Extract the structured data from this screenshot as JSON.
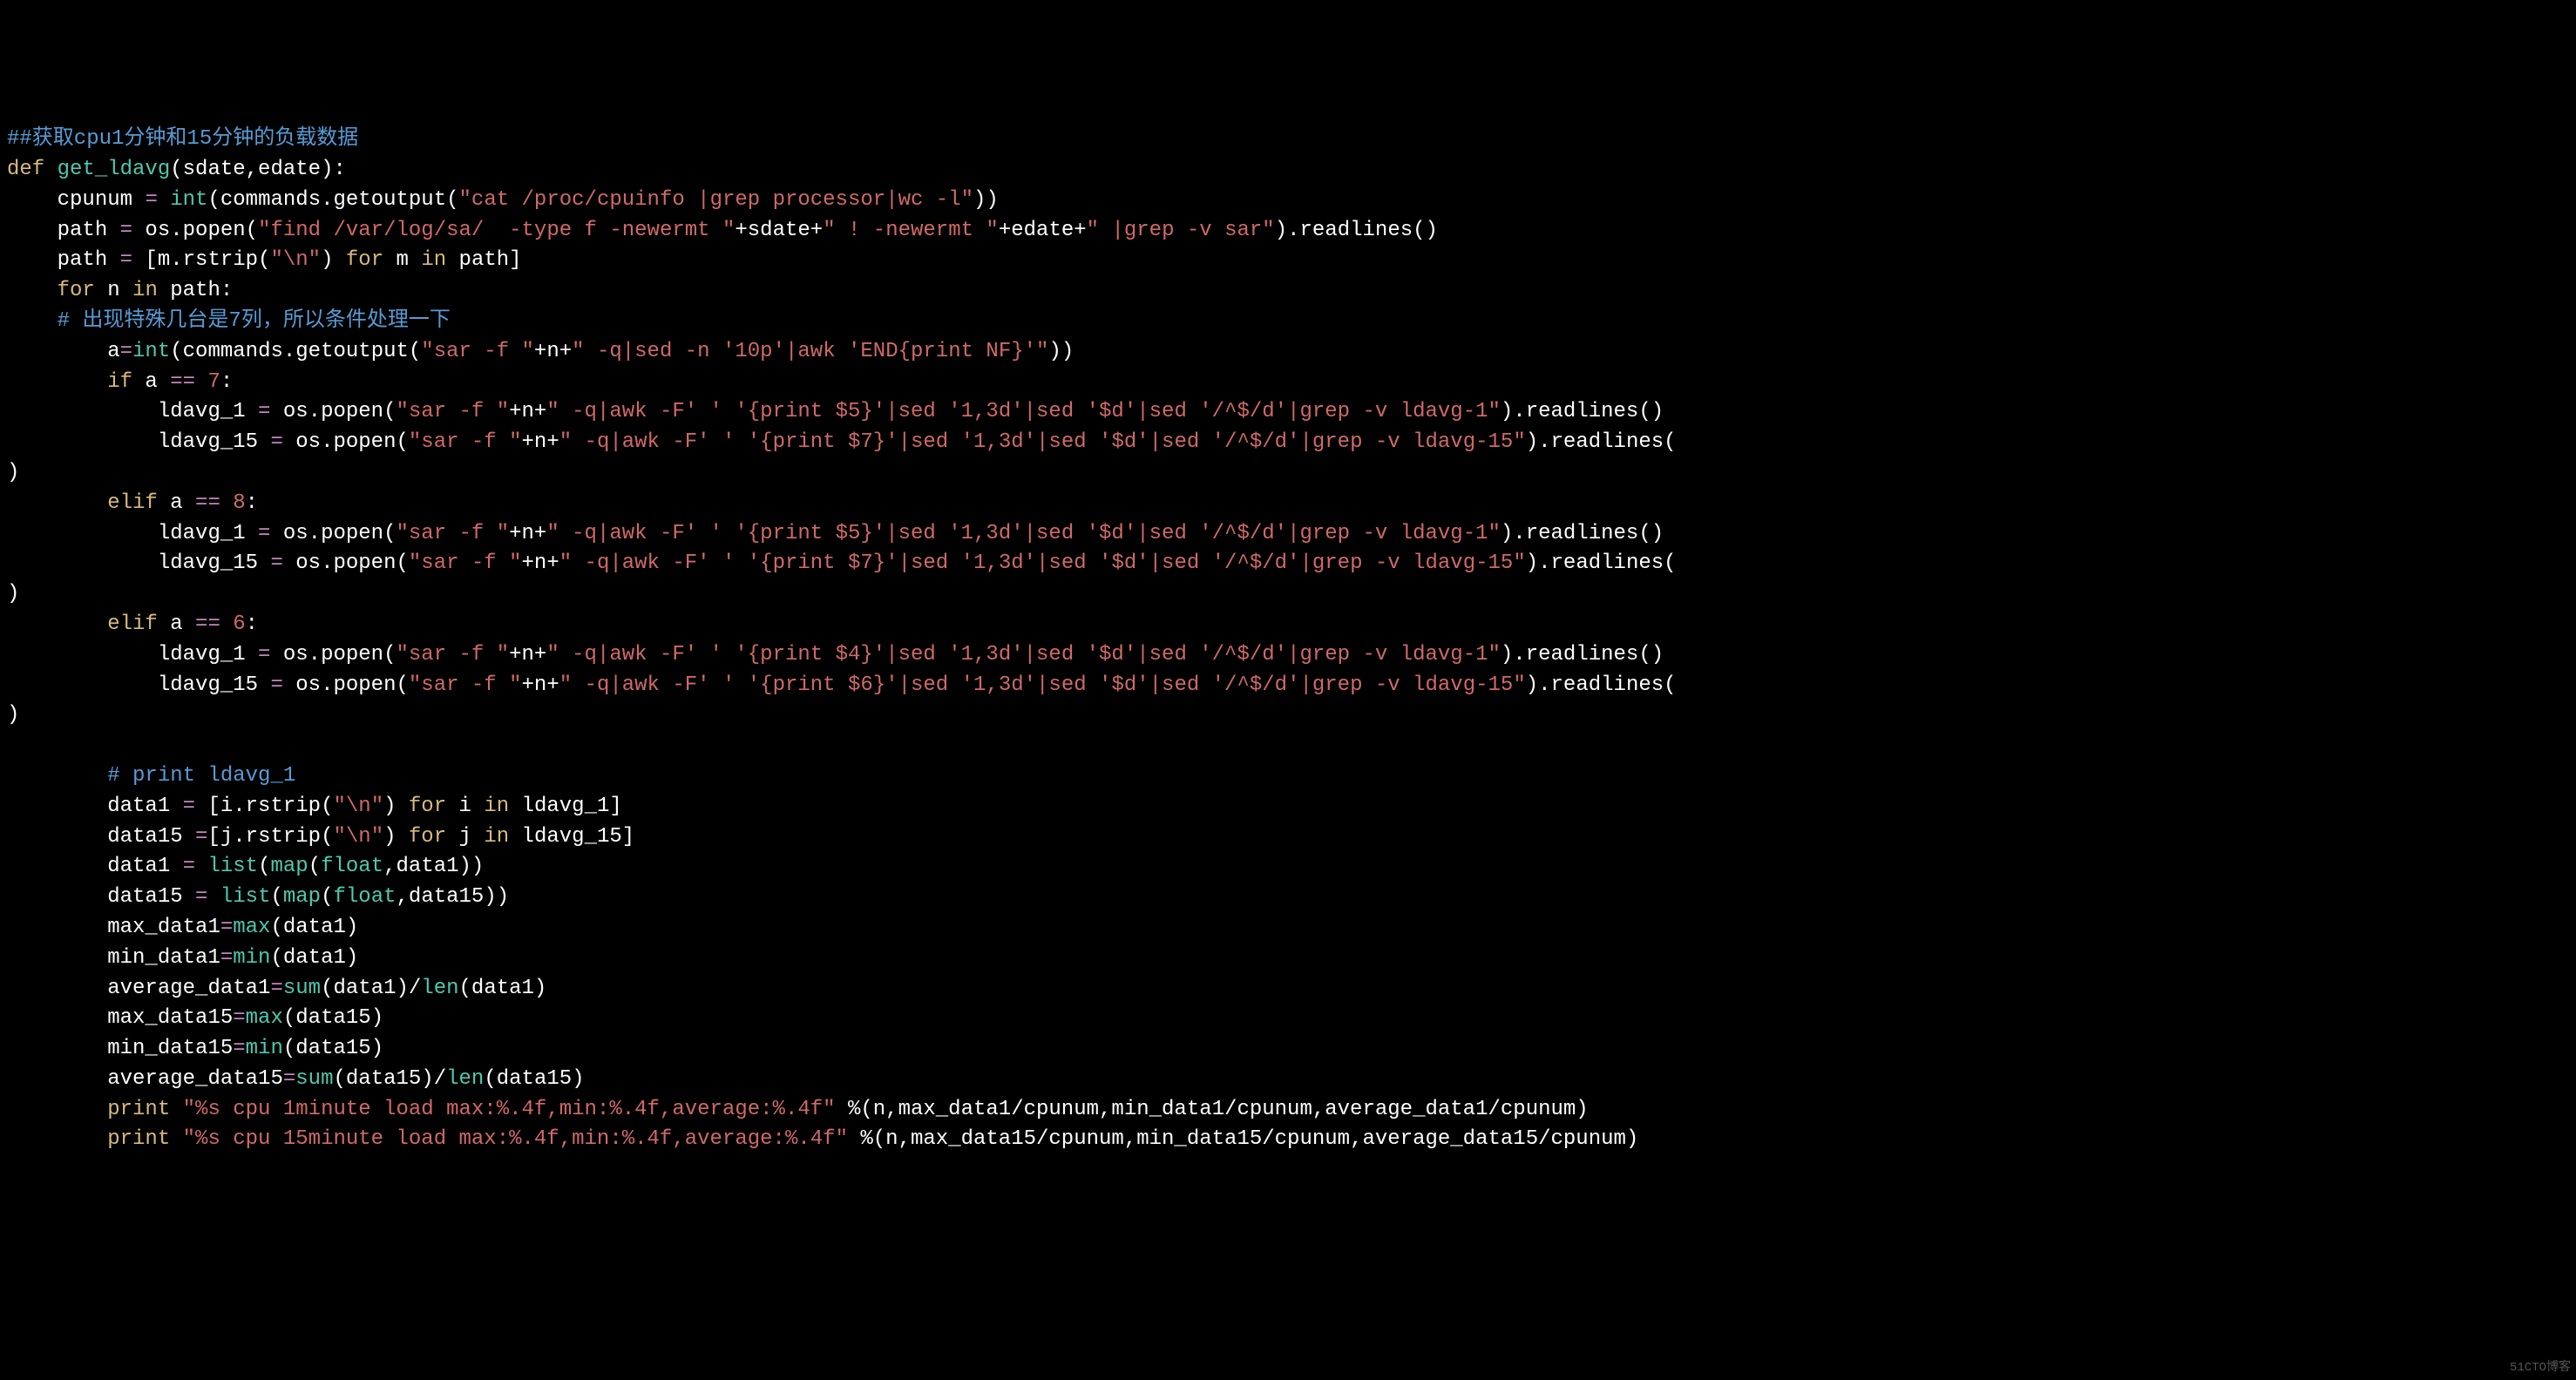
{
  "lines": [
    {
      "l": 1,
      "segs": [
        {
          "c": "c-comment",
          "t": "##获取cpu1分钟和15分钟的负载数据"
        }
      ]
    },
    {
      "l": 2,
      "segs": [
        {
          "c": "c-keyword",
          "t": "def "
        },
        {
          "c": "c-func",
          "t": "get_ldavg"
        },
        {
          "c": "c-white",
          "t": "(sdate,edate):"
        }
      ]
    },
    {
      "l": 3,
      "segs": [
        {
          "c": "c-white",
          "t": "    cpunum "
        },
        {
          "c": "c-op",
          "t": "="
        },
        {
          "c": "c-white",
          "t": " "
        },
        {
          "c": "c-func",
          "t": "int"
        },
        {
          "c": "c-white",
          "t": "(commands.getoutput("
        },
        {
          "c": "c-str",
          "t": "\"cat /proc/cpuinfo |grep processor|wc -l\""
        },
        {
          "c": "c-white",
          "t": "))"
        }
      ]
    },
    {
      "l": 4,
      "segs": [
        {
          "c": "c-white",
          "t": "    path "
        },
        {
          "c": "c-op",
          "t": "="
        },
        {
          "c": "c-white",
          "t": " os.popen("
        },
        {
          "c": "c-str",
          "t": "\"find /var/log/sa/  -type f -newermt \""
        },
        {
          "c": "c-white",
          "t": "+sdate+"
        },
        {
          "c": "c-str",
          "t": "\" ! -newermt \""
        },
        {
          "c": "c-white",
          "t": "+edate+"
        },
        {
          "c": "c-str",
          "t": "\" |grep -v sar\""
        },
        {
          "c": "c-white",
          "t": ").readlines()"
        }
      ]
    },
    {
      "l": 5,
      "segs": [
        {
          "c": "c-white",
          "t": "    path "
        },
        {
          "c": "c-op",
          "t": "="
        },
        {
          "c": "c-white",
          "t": " [m.rstrip("
        },
        {
          "c": "c-str",
          "t": "\"\\n\""
        },
        {
          "c": "c-white",
          "t": ") "
        },
        {
          "c": "c-keyword",
          "t": "for"
        },
        {
          "c": "c-white",
          "t": " m "
        },
        {
          "c": "c-keyword",
          "t": "in"
        },
        {
          "c": "c-white",
          "t": " path]"
        }
      ]
    },
    {
      "l": 6,
      "segs": [
        {
          "c": "c-white",
          "t": "    "
        },
        {
          "c": "c-keyword",
          "t": "for"
        },
        {
          "c": "c-white",
          "t": " n "
        },
        {
          "c": "c-keyword",
          "t": "in"
        },
        {
          "c": "c-white",
          "t": " path:"
        }
      ]
    },
    {
      "l": 7,
      "segs": [
        {
          "c": "c-white",
          "t": "    "
        },
        {
          "c": "c-comment",
          "t": "# 出现特殊几台是7列，所以条件处理一下"
        }
      ]
    },
    {
      "l": 8,
      "segs": [
        {
          "c": "c-white",
          "t": "        a"
        },
        {
          "c": "c-op",
          "t": "="
        },
        {
          "c": "c-func",
          "t": "int"
        },
        {
          "c": "c-white",
          "t": "(commands.getoutput("
        },
        {
          "c": "c-str",
          "t": "\"sar -f \""
        },
        {
          "c": "c-white",
          "t": "+n+"
        },
        {
          "c": "c-str",
          "t": "\" -q|sed -n '10p'|awk 'END{print NF}'\""
        },
        {
          "c": "c-white",
          "t": "))"
        }
      ]
    },
    {
      "l": 9,
      "segs": [
        {
          "c": "c-white",
          "t": "        "
        },
        {
          "c": "c-keyword",
          "t": "if"
        },
        {
          "c": "c-white",
          "t": " a "
        },
        {
          "c": "c-op",
          "t": "=="
        },
        {
          "c": "c-white",
          "t": " "
        },
        {
          "c": "c-num",
          "t": "7"
        },
        {
          "c": "c-white",
          "t": ":"
        }
      ]
    },
    {
      "l": 10,
      "segs": [
        {
          "c": "c-white",
          "t": "            ldavg_1 "
        },
        {
          "c": "c-op",
          "t": "="
        },
        {
          "c": "c-white",
          "t": " os.popen("
        },
        {
          "c": "c-str",
          "t": "\"sar -f \""
        },
        {
          "c": "c-white",
          "t": "+n+"
        },
        {
          "c": "c-str",
          "t": "\" -q|awk -F' ' '{print $5}'|sed '1,3d'|sed '$d'|sed '/^$/d'|grep -v ldavg-1\""
        },
        {
          "c": "c-white",
          "t": ").readlines()"
        }
      ]
    },
    {
      "l": 11,
      "segs": [
        {
          "c": "c-white",
          "t": "            ldavg_15 "
        },
        {
          "c": "c-op",
          "t": "="
        },
        {
          "c": "c-white",
          "t": " os.popen("
        },
        {
          "c": "c-str",
          "t": "\"sar -f \""
        },
        {
          "c": "c-white",
          "t": "+n+"
        },
        {
          "c": "c-str",
          "t": "\" -q|awk -F' ' '{print $7}'|sed '1,3d'|sed '$d'|sed '/^$/d'|grep -v ldavg-15\""
        },
        {
          "c": "c-white",
          "t": ").readlines("
        }
      ]
    },
    {
      "l": 12,
      "segs": [
        {
          "c": "c-white",
          "t": ")"
        }
      ]
    },
    {
      "l": 13,
      "segs": [
        {
          "c": "c-white",
          "t": "        "
        },
        {
          "c": "c-keyword",
          "t": "elif"
        },
        {
          "c": "c-white",
          "t": " a "
        },
        {
          "c": "c-op",
          "t": "=="
        },
        {
          "c": "c-white",
          "t": " "
        },
        {
          "c": "c-num",
          "t": "8"
        },
        {
          "c": "c-white",
          "t": ":"
        }
      ]
    },
    {
      "l": 14,
      "segs": [
        {
          "c": "c-white",
          "t": "            ldavg_1 "
        },
        {
          "c": "c-op",
          "t": "="
        },
        {
          "c": "c-white",
          "t": " os.popen("
        },
        {
          "c": "c-str",
          "t": "\"sar -f \""
        },
        {
          "c": "c-white",
          "t": "+n+"
        },
        {
          "c": "c-str",
          "t": "\" -q|awk -F' ' '{print $5}'|sed '1,3d'|sed '$d'|sed '/^$/d'|grep -v ldavg-1\""
        },
        {
          "c": "c-white",
          "t": ").readlines()"
        }
      ]
    },
    {
      "l": 15,
      "segs": [
        {
          "c": "c-white",
          "t": "            ldavg_15 "
        },
        {
          "c": "c-op",
          "t": "="
        },
        {
          "c": "c-white",
          "t": " os.popen("
        },
        {
          "c": "c-str",
          "t": "\"sar -f \""
        },
        {
          "c": "c-white",
          "t": "+n+"
        },
        {
          "c": "c-str",
          "t": "\" -q|awk -F' ' '{print $7}'|sed '1,3d'|sed '$d'|sed '/^$/d'|grep -v ldavg-15\""
        },
        {
          "c": "c-white",
          "t": ").readlines("
        }
      ]
    },
    {
      "l": 16,
      "segs": [
        {
          "c": "c-white",
          "t": ")"
        }
      ]
    },
    {
      "l": 17,
      "segs": [
        {
          "c": "c-white",
          "t": "        "
        },
        {
          "c": "c-keyword",
          "t": "elif"
        },
        {
          "c": "c-white",
          "t": " a "
        },
        {
          "c": "c-op",
          "t": "=="
        },
        {
          "c": "c-white",
          "t": " "
        },
        {
          "c": "c-num",
          "t": "6"
        },
        {
          "c": "c-white",
          "t": ":"
        }
      ]
    },
    {
      "l": 18,
      "segs": [
        {
          "c": "c-white",
          "t": "            ldavg_1 "
        },
        {
          "c": "c-op",
          "t": "="
        },
        {
          "c": "c-white",
          "t": " os.popen("
        },
        {
          "c": "c-str",
          "t": "\"sar -f \""
        },
        {
          "c": "c-white",
          "t": "+n+"
        },
        {
          "c": "c-str",
          "t": "\" -q|awk -F' ' '{print $4}'|sed '1,3d'|sed '$d'|sed '/^$/d'|grep -v ldavg-1\""
        },
        {
          "c": "c-white",
          "t": ").readlines()"
        }
      ]
    },
    {
      "l": 19,
      "segs": [
        {
          "c": "c-white",
          "t": "            ldavg_15 "
        },
        {
          "c": "c-op",
          "t": "="
        },
        {
          "c": "c-white",
          "t": " os.popen("
        },
        {
          "c": "c-str",
          "t": "\"sar -f \""
        },
        {
          "c": "c-white",
          "t": "+n+"
        },
        {
          "c": "c-str",
          "t": "\" -q|awk -F' ' '{print $6}'|sed '1,3d'|sed '$d'|sed '/^$/d'|grep -v ldavg-15\""
        },
        {
          "c": "c-white",
          "t": ").readlines("
        }
      ]
    },
    {
      "l": 20,
      "segs": [
        {
          "c": "c-white",
          "t": ")"
        }
      ]
    },
    {
      "l": 21,
      "segs": [
        {
          "c": "c-white",
          "t": ""
        }
      ]
    },
    {
      "l": 22,
      "segs": [
        {
          "c": "c-white",
          "t": "        "
        },
        {
          "c": "c-comment",
          "t": "# print ldavg_1"
        }
      ]
    },
    {
      "l": 23,
      "segs": [
        {
          "c": "c-white",
          "t": "        data1 "
        },
        {
          "c": "c-op",
          "t": "="
        },
        {
          "c": "c-white",
          "t": " [i.rstrip("
        },
        {
          "c": "c-str",
          "t": "\"\\n\""
        },
        {
          "c": "c-white",
          "t": ") "
        },
        {
          "c": "c-keyword",
          "t": "for"
        },
        {
          "c": "c-white",
          "t": " i "
        },
        {
          "c": "c-keyword",
          "t": "in"
        },
        {
          "c": "c-white",
          "t": " ldavg_1]"
        }
      ]
    },
    {
      "l": 24,
      "segs": [
        {
          "c": "c-white",
          "t": "        data15 "
        },
        {
          "c": "c-op",
          "t": "="
        },
        {
          "c": "c-white",
          "t": "[j.rstrip("
        },
        {
          "c": "c-str",
          "t": "\"\\n\""
        },
        {
          "c": "c-white",
          "t": ") "
        },
        {
          "c": "c-keyword",
          "t": "for"
        },
        {
          "c": "c-white",
          "t": " j "
        },
        {
          "c": "c-keyword",
          "t": "in"
        },
        {
          "c": "c-white",
          "t": " ldavg_15]"
        }
      ]
    },
    {
      "l": 25,
      "segs": [
        {
          "c": "c-white",
          "t": "        data1 "
        },
        {
          "c": "c-op",
          "t": "="
        },
        {
          "c": "c-white",
          "t": " "
        },
        {
          "c": "c-func",
          "t": "list"
        },
        {
          "c": "c-white",
          "t": "("
        },
        {
          "c": "c-func",
          "t": "map"
        },
        {
          "c": "c-white",
          "t": "("
        },
        {
          "c": "c-func",
          "t": "float"
        },
        {
          "c": "c-white",
          "t": ",data1))"
        }
      ]
    },
    {
      "l": 26,
      "segs": [
        {
          "c": "c-white",
          "t": "        data15 "
        },
        {
          "c": "c-op",
          "t": "="
        },
        {
          "c": "c-white",
          "t": " "
        },
        {
          "c": "c-func",
          "t": "list"
        },
        {
          "c": "c-white",
          "t": "("
        },
        {
          "c": "c-func",
          "t": "map"
        },
        {
          "c": "c-white",
          "t": "("
        },
        {
          "c": "c-func",
          "t": "float"
        },
        {
          "c": "c-white",
          "t": ",data15))"
        }
      ]
    },
    {
      "l": 27,
      "segs": [
        {
          "c": "c-white",
          "t": "        max_data1"
        },
        {
          "c": "c-op",
          "t": "="
        },
        {
          "c": "c-func",
          "t": "max"
        },
        {
          "c": "c-white",
          "t": "(data1)"
        }
      ]
    },
    {
      "l": 28,
      "segs": [
        {
          "c": "c-white",
          "t": "        min_data1"
        },
        {
          "c": "c-op",
          "t": "="
        },
        {
          "c": "c-func",
          "t": "min"
        },
        {
          "c": "c-white",
          "t": "(data1)"
        }
      ]
    },
    {
      "l": 29,
      "segs": [
        {
          "c": "c-white",
          "t": "        average_data1"
        },
        {
          "c": "c-op",
          "t": "="
        },
        {
          "c": "c-func",
          "t": "sum"
        },
        {
          "c": "c-white",
          "t": "(data1)/"
        },
        {
          "c": "c-func",
          "t": "len"
        },
        {
          "c": "c-white",
          "t": "(data1)"
        }
      ]
    },
    {
      "l": 30,
      "segs": [
        {
          "c": "c-white",
          "t": "        max_data15"
        },
        {
          "c": "c-op",
          "t": "="
        },
        {
          "c": "c-func",
          "t": "max"
        },
        {
          "c": "c-white",
          "t": "(data15)"
        }
      ]
    },
    {
      "l": 31,
      "segs": [
        {
          "c": "c-white",
          "t": "        min_data15"
        },
        {
          "c": "c-op",
          "t": "="
        },
        {
          "c": "c-func",
          "t": "min"
        },
        {
          "c": "c-white",
          "t": "(data15)"
        }
      ]
    },
    {
      "l": 32,
      "segs": [
        {
          "c": "c-white",
          "t": "        average_data15"
        },
        {
          "c": "c-op",
          "t": "="
        },
        {
          "c": "c-func",
          "t": "sum"
        },
        {
          "c": "c-white",
          "t": "(data15)/"
        },
        {
          "c": "c-func",
          "t": "len"
        },
        {
          "c": "c-white",
          "t": "(data15)"
        }
      ]
    },
    {
      "l": 33,
      "segs": [
        {
          "c": "c-white",
          "t": "        "
        },
        {
          "c": "c-keyword",
          "t": "print"
        },
        {
          "c": "c-white",
          "t": " "
        },
        {
          "c": "c-str",
          "t": "\"%s cpu 1minute load max:%.4f,min:%.4f,average:%.4f\""
        },
        {
          "c": "c-white",
          "t": " %(n,max_data1/cpunum,min_data1/cpunum,average_data1/cpunum)"
        }
      ]
    },
    {
      "l": 34,
      "segs": [
        {
          "c": "c-white",
          "t": "        "
        },
        {
          "c": "c-keyword",
          "t": "print"
        },
        {
          "c": "c-white",
          "t": " "
        },
        {
          "c": "c-str",
          "t": "\"%s cpu 15minute load max:%.4f,min:%.4f,average:%.4f\""
        },
        {
          "c": "c-white",
          "t": " %(n,max_data15/cpunum,min_data15/cpunum,average_data15/cpunum)"
        }
      ]
    }
  ],
  "watermark": "51CTO博客"
}
